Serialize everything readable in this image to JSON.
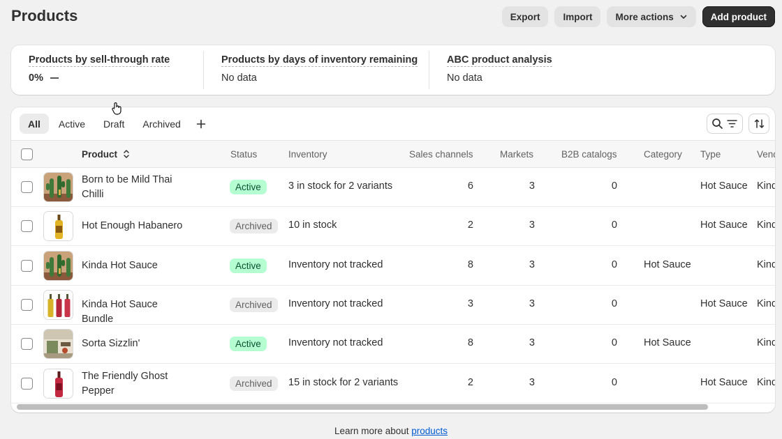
{
  "page": {
    "title": "Products"
  },
  "header_actions": {
    "export": "Export",
    "import": "Import",
    "more_actions": "More actions",
    "add_product": "Add product"
  },
  "analytics": {
    "metrics": [
      {
        "title": "Products by sell-through rate",
        "value": "0%"
      },
      {
        "title": "Products by days of inventory remaining",
        "value": "No data"
      },
      {
        "title": "ABC product analysis",
        "value": "No data"
      }
    ]
  },
  "tabs": [
    "All",
    "Active",
    "Draft",
    "Archived"
  ],
  "table": {
    "columns": [
      "Product",
      "Status",
      "Inventory",
      "Sales channels",
      "Markets",
      "B2B catalogs",
      "Category",
      "Type",
      "Vendor"
    ],
    "rows": [
      {
        "name": "Born to be Mild Thai Chilli",
        "status": "Active",
        "inventory": "3 in stock for 2 variants",
        "sales_channels": "6",
        "markets": "3",
        "b2b": "0",
        "category": "",
        "type": "Hot Sauce",
        "vendor": "Kinda",
        "thumb": "cactus-image"
      },
      {
        "name": "Hot Enough Habanero",
        "status": "Archived",
        "inventory": "10 in stock",
        "sales_channels": "2",
        "markets": "3",
        "b2b": "0",
        "category": "",
        "type": "Hot Sauce",
        "vendor": "Kinda",
        "thumb": "yellow-bottle-image"
      },
      {
        "name": "Kinda Hot Sauce",
        "status": "Active",
        "inventory": "Inventory not tracked",
        "sales_channels": "8",
        "markets": "3",
        "b2b": "0",
        "category": "Hot Sauce",
        "type": "",
        "vendor": "Kinda",
        "thumb": "cactus-image"
      },
      {
        "name": "Kinda Hot Sauce Bundle",
        "status": "Archived",
        "inventory": "Inventory not tracked",
        "sales_channels": "3",
        "markets": "3",
        "b2b": "0",
        "category": "",
        "type": "Hot Sauce",
        "vendor": "Kinda",
        "thumb": "bottles-bundle-image"
      },
      {
        "name": "Sorta Sizzlin'",
        "status": "Active",
        "inventory": "Inventory not tracked",
        "sales_channels": "8",
        "markets": "3",
        "b2b": "0",
        "category": "Hot Sauce",
        "type": "",
        "vendor": "Kinda",
        "thumb": "kitchen-image"
      },
      {
        "name": "The Friendly Ghost Pepper",
        "status": "Archived",
        "inventory": "15 in stock for 2 variants",
        "sales_channels": "2",
        "markets": "3",
        "b2b": "0",
        "category": "",
        "type": "Hot Sauce",
        "vendor": "Kinda",
        "thumb": "red-bottle-image"
      }
    ]
  },
  "footer": {
    "text": "Learn more about ",
    "link": "products"
  },
  "colors": {
    "active_badge_bg": "#b4fed2",
    "archived_badge_bg": "#ebebeb",
    "primary_button": "#303030",
    "link": "#005bd3"
  }
}
